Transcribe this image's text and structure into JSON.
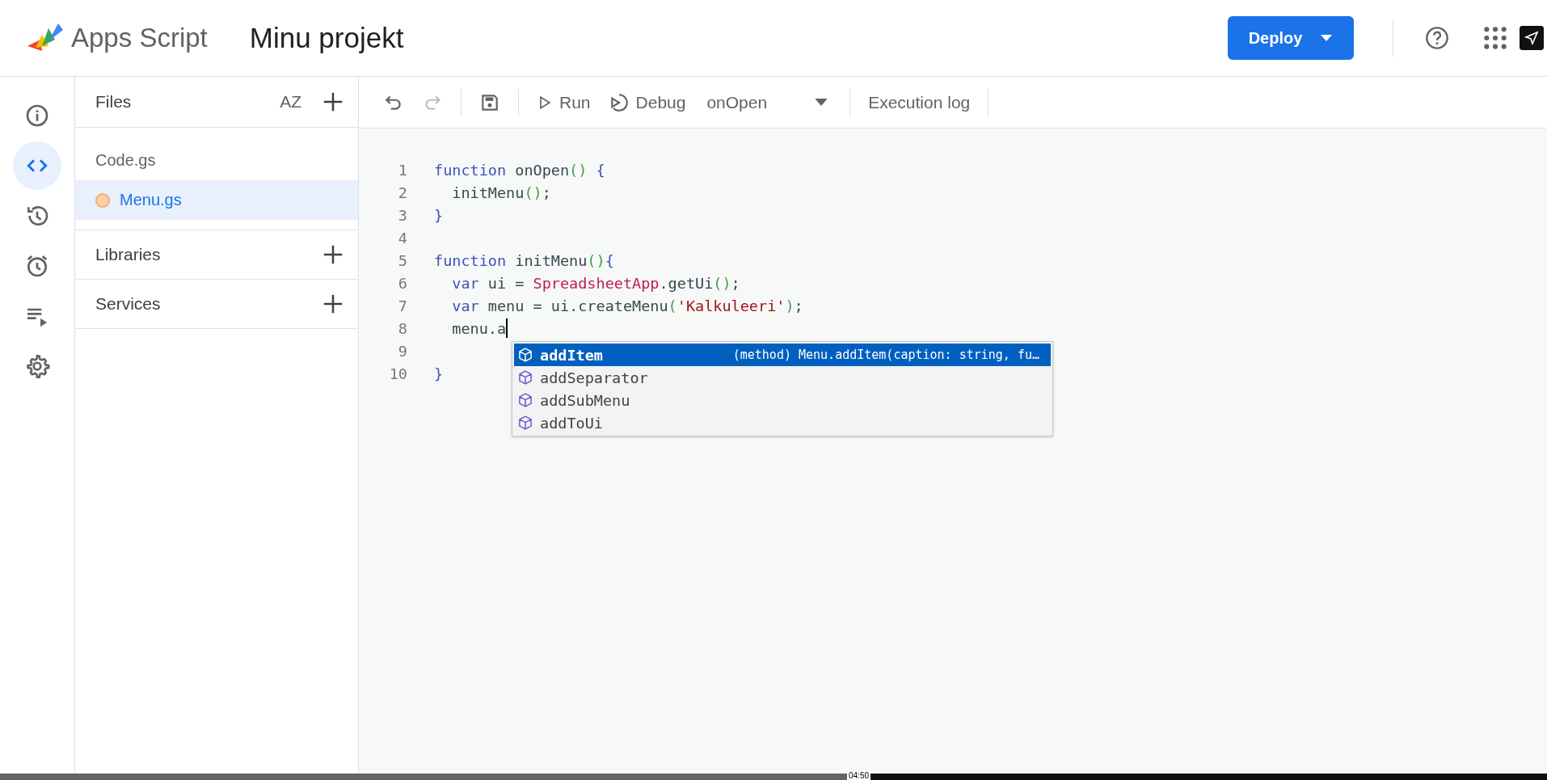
{
  "header": {
    "app_name": "Apps Script",
    "project_title": "Minu projekt",
    "deploy_button": "Deploy"
  },
  "rail": [
    {
      "kind": "info",
      "selected": false
    },
    {
      "kind": "code",
      "selected": true
    },
    {
      "kind": "history",
      "selected": false
    },
    {
      "kind": "triggers",
      "selected": false
    },
    {
      "kind": "executions",
      "selected": false
    },
    {
      "kind": "settings",
      "selected": false
    }
  ],
  "files_panel": {
    "title": "Files",
    "sort_label": "AZ",
    "files": [
      {
        "name": "Code.gs",
        "selected": false,
        "unsaved": false
      },
      {
        "name": "Menu.gs",
        "selected": true,
        "unsaved": true
      }
    ],
    "sections": [
      {
        "title": "Libraries"
      },
      {
        "title": "Services"
      }
    ]
  },
  "toolbar": {
    "undo_disabled": false,
    "redo_disabled": true,
    "run": "Run",
    "debug": "Debug",
    "function": "onOpen",
    "execution_log": "Execution log"
  },
  "editor": {
    "lines": [
      {
        "number": "1",
        "tokens": [
          {
            "kind": "keyword",
            "text": "function"
          },
          {
            "kind": "plain",
            "text": " onOpen"
          },
          {
            "kind": "paren",
            "text": "()"
          },
          {
            "kind": "brace",
            "text": " {"
          }
        ]
      },
      {
        "number": "2",
        "tokens": [
          {
            "kind": "plain",
            "text": "  initMenu"
          },
          {
            "kind": "paren",
            "text": "()"
          },
          {
            "kind": "plain",
            "text": ";"
          }
        ]
      },
      {
        "number": "3",
        "tokens": [
          {
            "kind": "brace",
            "text": "}"
          }
        ]
      },
      {
        "number": "4"
      },
      {
        "number": "5",
        "tokens": [
          {
            "kind": "keyword",
            "text": "function"
          },
          {
            "kind": "plain",
            "text": " initMenu"
          },
          {
            "kind": "paren",
            "text": "()"
          },
          {
            "kind": "brace",
            "text": "{"
          }
        ]
      },
      {
        "number": "6",
        "tokens": [
          {
            "kind": "keyword",
            "text": "  var"
          },
          {
            "kind": "plain",
            "text": " ui = "
          },
          {
            "kind": "class",
            "text": "SpreadsheetApp"
          },
          {
            "kind": "plain",
            "text": ".getUi"
          },
          {
            "kind": "paren",
            "text": "()"
          },
          {
            "kind": "plain",
            "text": ";"
          }
        ]
      },
      {
        "number": "7",
        "tokens": [
          {
            "kind": "keyword",
            "text": "  var"
          },
          {
            "kind": "plain",
            "text": " menu = ui.createMenu"
          },
          {
            "kind": "paren",
            "text": "("
          },
          {
            "kind": "string",
            "text": "'Kalkuleeri'"
          },
          {
            "kind": "paren",
            "text": ")"
          },
          {
            "kind": "plain",
            "text": ";"
          }
        ]
      },
      {
        "number": "8",
        "tokens": [
          {
            "kind": "plain",
            "text": "  menu.a"
          }
        ],
        "cursor": true
      },
      {
        "number": "9"
      },
      {
        "number": "10",
        "tokens": [
          {
            "kind": "brace",
            "text": "}"
          }
        ]
      }
    ],
    "suggestions": [
      {
        "label": "addItem",
        "detail": "(method) Menu.addItem(caption: string, fu…",
        "selected": true
      },
      {
        "label": "addSeparator",
        "selected": false
      },
      {
        "label": "addSubMenu",
        "selected": false
      },
      {
        "label": "addToUi",
        "selected": false
      }
    ]
  },
  "video_player": {
    "time": "04:50",
    "level": 0.55
  }
}
